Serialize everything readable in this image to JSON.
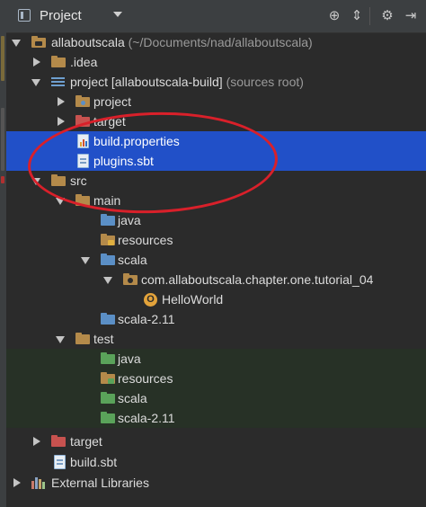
{
  "header": {
    "title": "Project"
  },
  "tree": {
    "root": {
      "name": "allaboutscala",
      "path": "(~/Documents/nad/allaboutscala)"
    },
    "idea": ".idea",
    "project_module": {
      "name": "project",
      "module_tag": "[allaboutscala-build]",
      "note": "(sources root)"
    },
    "project_sub": "project",
    "target_sub": "target",
    "build_properties": "build.properties",
    "plugins_sbt": "plugins.sbt",
    "src": "src",
    "main": "main",
    "main_java": "java",
    "main_resources": "resources",
    "main_scala": "scala",
    "package": "com.allaboutscala.chapter.one.tutorial_04",
    "class_name": "HelloWorld",
    "class_badge": "O",
    "main_scala_211": "scala-2.11",
    "test": "test",
    "test_java": "java",
    "test_resources": "resources",
    "test_scala": "scala",
    "test_scala_211": "scala-2.11",
    "target_root": "target",
    "build_sbt": "build.sbt",
    "external_libraries": "External Libraries"
  },
  "colors": {
    "selection": "#2150c8",
    "annotation": "#d9202a",
    "folder_plain": "#b48a4a",
    "folder_source": "#5b8fc6",
    "folder_test": "#5aa35a",
    "folder_excluded": "#c7524f",
    "folder_resource": "#b48a4a"
  },
  "icons": {
    "view": "project-view-icon",
    "locate": "crosshair-icon",
    "collapse": "collapse-all-icon",
    "settings": "gear-icon",
    "hide": "hide-panel-icon"
  }
}
